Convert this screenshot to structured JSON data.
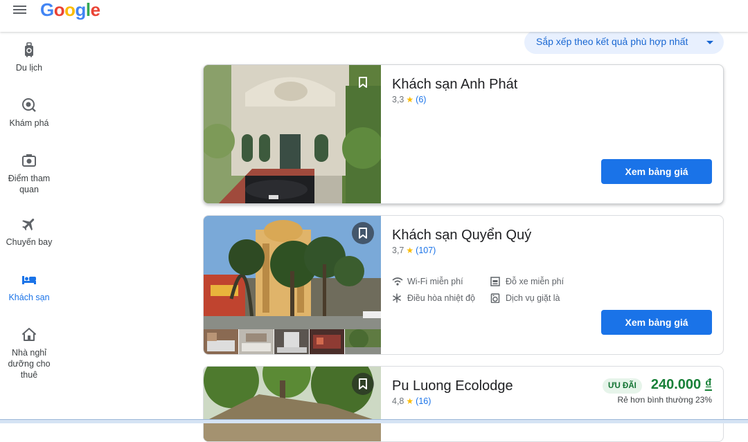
{
  "header": {
    "logo_text": "Google",
    "menu_icon": "hamburger-icon"
  },
  "sidebar": {
    "items": [
      {
        "label": "Du lịch",
        "icon": "luggage-icon",
        "active": false
      },
      {
        "label": "Khám phá",
        "icon": "explore-icon",
        "active": false
      },
      {
        "label": "Điểm tham quan",
        "icon": "camera-icon",
        "active": false
      },
      {
        "label": "Chuyến bay",
        "icon": "airplane-icon",
        "active": false
      },
      {
        "label": "Khách sạn",
        "icon": "hotel-bed-icon",
        "active": true
      },
      {
        "label": "Nhà nghỉ dưỡng cho thuê",
        "icon": "house-icon",
        "active": false
      }
    ],
    "active_color": "#1a73e8"
  },
  "sort": {
    "label": "Sắp xếp theo kết quả phù hợp nhất"
  },
  "results": [
    {
      "name": "Khách sạn Anh Phát",
      "rating": "3,3",
      "reviews": "(6)",
      "button": "Xem bảng giá"
    },
    {
      "name": "Khách sạn Quyển Quý",
      "rating": "3,7",
      "reviews": "(107)",
      "amenities": [
        "Wi-Fi miễn phí",
        "Đỗ xe miễn phí",
        "Điều hòa nhiệt độ",
        "Dịch vụ giặt là"
      ],
      "button": "Xem bảng giá"
    },
    {
      "name": "Pu Luong Ecolodge",
      "rating": "4,8",
      "reviews": "(16)",
      "deal_badge": "ƯU ĐÃI",
      "price": "240.000",
      "currency": "₫",
      "deal_note": "Rẻ hơn bình thường 23%"
    }
  ],
  "colors": {
    "primary": "#1a73e8",
    "deal_green": "#188038",
    "star": "#fbbc04"
  }
}
